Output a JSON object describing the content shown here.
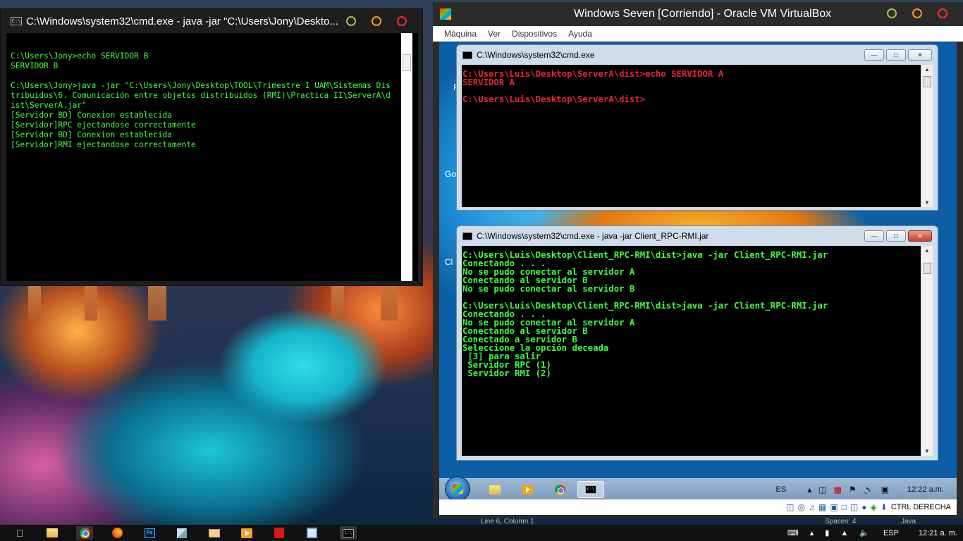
{
  "host_cmd": {
    "title": "C:\\Windows\\system32\\cmd.exe - java  -jar \"C:\\Users\\Jony\\Deskto...",
    "lines": [
      "C:\\Users\\Jony>echo SERVIDOR B",
      "SERVIDOR B",
      "",
      "C:\\Users\\Jony>java -jar \"C:\\Users\\Jony\\Desktop\\TOOL\\Trimestre I UAM\\Sistemas Dis",
      "tribuidos\\6. Comunicación entre objetos distribuidos (RMI)\\Practica II\\ServerA\\d",
      "ist\\ServerA.jar\"",
      "[Servidor BD] Conexion establecida",
      "[Servidor]RPC ejectandose correctamente",
      "[Servidor BD] Conexion establecida",
      "[Servidor]RMI ejectandose correctamente"
    ],
    "text_color": "#3cff3c"
  },
  "vbox": {
    "title": "Windows Seven [Corriendo] - Oracle VM VirtualBox",
    "menu": [
      "Máquina",
      "Ver",
      "Dispositivos",
      "Ayuda"
    ],
    "desktop_letters": [
      "P",
      "Go",
      "Cl"
    ],
    "guest_cmd_a": {
      "title": "C:\\Windows\\system32\\cmd.exe",
      "lines": [
        "C:\\Users\\Luis\\Desktop\\ServerA\\dist>echo SERVIDOR A",
        "SERVIDOR A",
        "",
        "C:\\Users\\Luis\\Desktop\\ServerA\\dist>"
      ],
      "text_color": "#e8262c"
    },
    "guest_cmd_b": {
      "title": "C:\\Windows\\system32\\cmd.exe - java  -jar Client_RPC-RMI.jar",
      "lines": [
        "C:\\Users\\Luis\\Desktop\\Client_RPC-RMI\\dist>java -jar Client_RPC-RMI.jar",
        "Conectando . . .",
        "No se pudo conectar al servidor A",
        "Conectando al servidor B",
        "No se pudo conectar al servidor B",
        "",
        "C:\\Users\\Luis\\Desktop\\Client_RPC-RMI\\dist>java -jar Client_RPC-RMI.jar",
        "Conectando . . .",
        "No se pudo conectar al servidor A",
        "Conectando al servidor B",
        "Conectado a servidor B",
        "Seleccione la opción deceada",
        " [3] para salir",
        " Servidor RPC (1)",
        " Servidor RMI (2)"
      ],
      "text_color": "#3cff3c"
    },
    "guest_taskbar": {
      "language": "ES",
      "clock": "12:22 a.m."
    },
    "status": {
      "host_key": "CTRL DERECHA"
    }
  },
  "host_taskbar": {
    "language": "ESP",
    "clock": "12:21 a. m."
  },
  "background_text": {
    "line_col": "Line 6, Column 1",
    "spaces": "Spaces: 4",
    "language_mode": "Java"
  }
}
